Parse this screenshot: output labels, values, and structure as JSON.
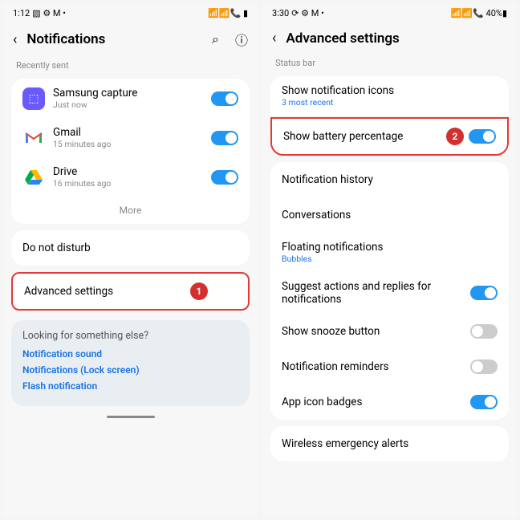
{
  "left": {
    "status": {
      "time": "1:12",
      "icons": "▧ ⚙ M •",
      "right": "📶📶📞 ▮"
    },
    "title": "Notifications",
    "section1": "Recently sent",
    "apps": [
      {
        "name": "Samsung capture",
        "sub": "Just now",
        "color": "#6a5aff",
        "letter": "⬚"
      },
      {
        "name": "Gmail",
        "sub": "15 minutes ago",
        "color": "#fff",
        "letter": "M"
      },
      {
        "name": "Drive",
        "sub": "16 minutes ago",
        "color": "#fff",
        "letter": "△"
      }
    ],
    "more": "More",
    "dnd": "Do not disturb",
    "adv": "Advanced settings",
    "badge1": "1",
    "suggest": {
      "title": "Looking for something else?",
      "links": [
        "Notification sound",
        "Notifications (Lock screen)",
        "Flash notification"
      ]
    }
  },
  "right": {
    "status": {
      "time": "3:30",
      "icons": "⟳ ⚙ M •",
      "right": "📶📶📞 40%▮"
    },
    "title": "Advanced settings",
    "section1": "Status bar",
    "r1": {
      "title": "Show notification icons",
      "sub": "3 most recent"
    },
    "r2": {
      "title": "Show battery percentage"
    },
    "badge2": "2",
    "items": [
      {
        "title": "Notification history"
      },
      {
        "title": "Conversations"
      },
      {
        "title": "Floating notifications",
        "sub": "Bubbles"
      },
      {
        "title": "Suggest actions and replies for notifications",
        "toggle": "on"
      },
      {
        "title": "Show snooze button",
        "toggle": "off"
      },
      {
        "title": "Notification reminders",
        "toggle": "off"
      },
      {
        "title": "App icon badges",
        "toggle": "on"
      }
    ],
    "last": "Wireless emergency alerts"
  }
}
